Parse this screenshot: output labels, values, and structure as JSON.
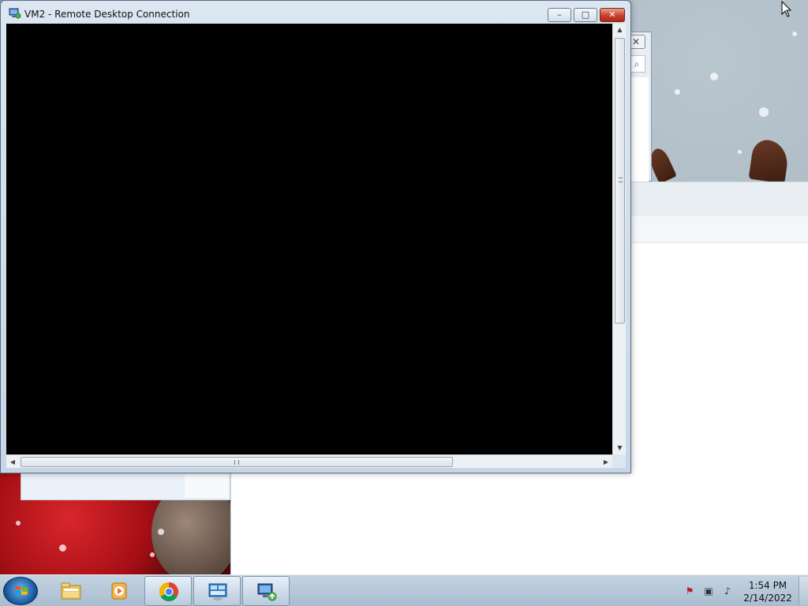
{
  "rdp_window": {
    "title": "VM2 - Remote Desktop Connection",
    "minimize_glyph": "–",
    "maximize_glyph": "□",
    "close_glyph": "✕"
  },
  "background_window": {
    "close_glyph": "✕",
    "search_glyph": "⌕"
  },
  "taskbar": {
    "pinned": [
      {
        "name": "windows-explorer",
        "active": false
      },
      {
        "name": "media-player",
        "active": false
      },
      {
        "name": "google-chrome",
        "active": true
      },
      {
        "name": "control-panel",
        "active": true
      },
      {
        "name": "remote-desktop-connection",
        "active": true
      }
    ]
  },
  "tray": {
    "flag_glyph": "⚑",
    "network_glyph": "▣",
    "volume_glyph": "♪",
    "time": "1:54 PM",
    "date": "2/14/2022"
  },
  "colors": {
    "rdp_client_bg": "#000000",
    "taskbar_top": "#c4d3e1",
    "close_button": "#c8402c"
  }
}
